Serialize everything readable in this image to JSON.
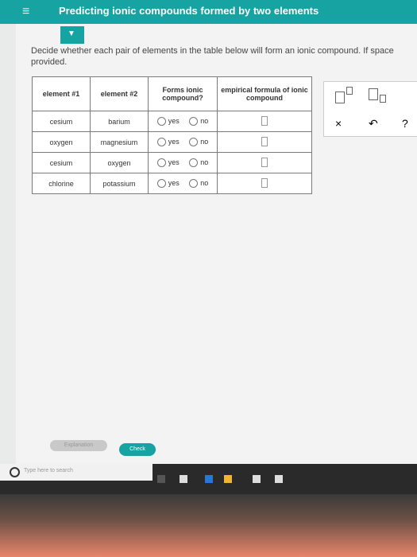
{
  "header": {
    "menu_icon": "menu-icon",
    "title": "Predicting ionic compounds formed by two elements"
  },
  "instructions": "Decide whether each pair of elements in the table below will form an ionic compound. If space provided.",
  "table": {
    "headers": [
      "element #1",
      "element #2",
      "Forms ionic compound?",
      "empirical formula of ionic compound"
    ],
    "rows": [
      {
        "e1": "cesium",
        "e2": "barium",
        "yes": "yes",
        "no": "no"
      },
      {
        "e1": "oxygen",
        "e2": "magnesium",
        "yes": "yes",
        "no": "no"
      },
      {
        "e1": "cesium",
        "e2": "oxygen",
        "yes": "yes",
        "no": "no"
      },
      {
        "e1": "chlorine",
        "e2": "potassium",
        "yes": "yes",
        "no": "no"
      }
    ]
  },
  "tools": {
    "clear": "×",
    "undo": "↶",
    "help": "?"
  },
  "buttons": {
    "explanation": "Explanation",
    "check": "Check"
  },
  "taskbar": {
    "search_placeholder": "Type here to search"
  }
}
